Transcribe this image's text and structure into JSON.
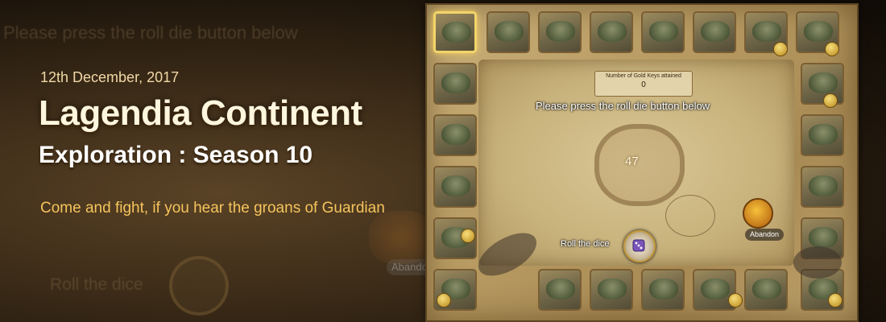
{
  "banner": {
    "date": "12th December, 2017",
    "title_line1": "Lagendia Continent",
    "title_line2": "Exploration : Season 10",
    "tagline": "Come and fight, if you hear the groans of Guardian"
  },
  "background_ghost": {
    "prompt": "Please press the roll die button below",
    "roll_label": "Roll the dice",
    "abandon": "Abandon"
  },
  "board": {
    "gold_keys_label": "Number of Gold Keys attained",
    "gold_keys_value": "0",
    "prompt": "Please press the roll die button below",
    "center_number": "47",
    "roll_label": "Roll the dice",
    "abandon_label": "Abandon",
    "roll_icon": "die-icon"
  },
  "colors": {
    "title": "#fff6de",
    "tagline": "#f5c45c",
    "date": "#f1d8a6",
    "active_tile_border": "#f3d46a"
  }
}
